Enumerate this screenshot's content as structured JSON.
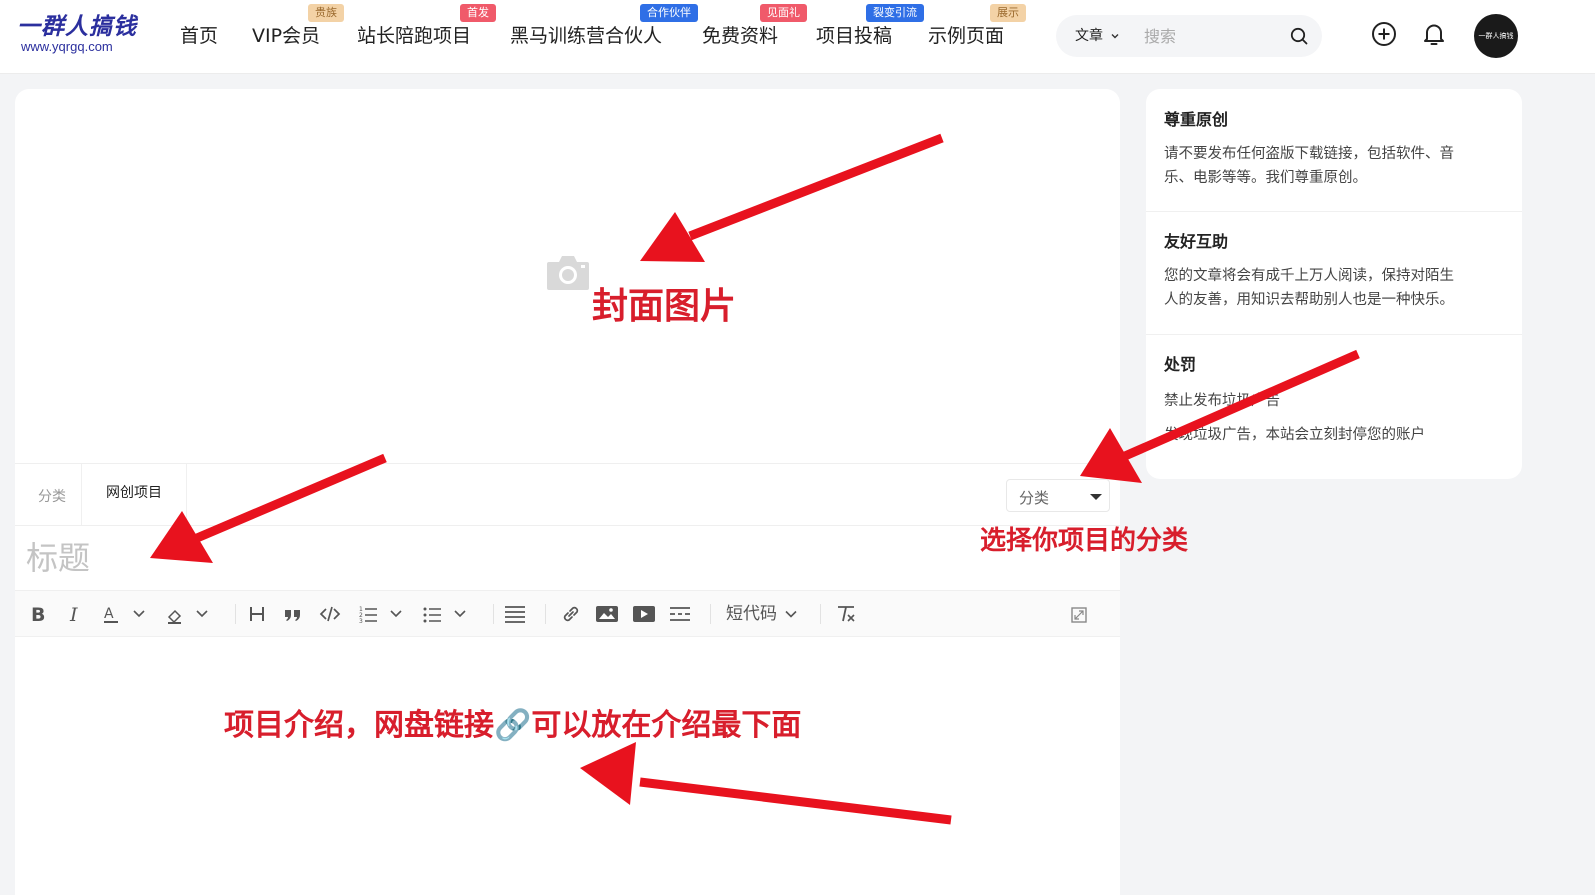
{
  "header": {
    "logo_text": "一群人搞钱",
    "logo_url": "www.yqrgq.com",
    "nav": [
      {
        "label": "首页",
        "badge": "",
        "badge_color": ""
      },
      {
        "label": "VIP会员",
        "badge": "贵族",
        "badge_color": "#f3d2a6"
      },
      {
        "label": "站长陪跑项目",
        "badge": "首发",
        "badge_color": "#f05a6a"
      },
      {
        "label": "黑马训练营合伙人",
        "badge": "合作伙伴",
        "badge_color": "#2f6fe6"
      },
      {
        "label": "免费资料",
        "badge": "见面礼",
        "badge_color": "#f05a6a"
      },
      {
        "label": "项目投稿",
        "badge": "裂变引流",
        "badge_color": "#2f6fe6"
      },
      {
        "label": "示例页面",
        "badge": "展示",
        "badge_color": "#f3d2a6"
      }
    ],
    "search": {
      "type_label": "文章",
      "placeholder": "搜索"
    },
    "avatar_text": "一群人搞钱"
  },
  "editor": {
    "category_label": "分类",
    "category_tag": "网创项目",
    "category_select": "分类",
    "title_placeholder": "标题",
    "toolbar": {
      "shortcode_label": "短代码"
    }
  },
  "sidebar": {
    "sections": [
      {
        "title": "尊重原创",
        "lines": [
          "请不要发布任何盗版下载链接，包括软件、音",
          "乐、电影等等。我们尊重原创。"
        ]
      },
      {
        "title": "友好互助",
        "lines": [
          "您的文章将会有成千上万人阅读，保持对陌生",
          "人的友善，用知识去帮助别人也是一种快乐。"
        ]
      },
      {
        "title": "处罚",
        "lines": [
          "禁止发布垃圾广告",
          "发现垃圾广告，本站会立刻封停您的账户"
        ]
      }
    ]
  },
  "annotations": {
    "cover": "封面图片",
    "category": "选择你项目的分类",
    "content": "项目介绍，网盘链接🔗可以放在介绍最下面",
    "color": "#d81e2c"
  },
  "colors": {
    "badge_text_light": "#9b6a2e",
    "accent_red": "#e8121e"
  }
}
